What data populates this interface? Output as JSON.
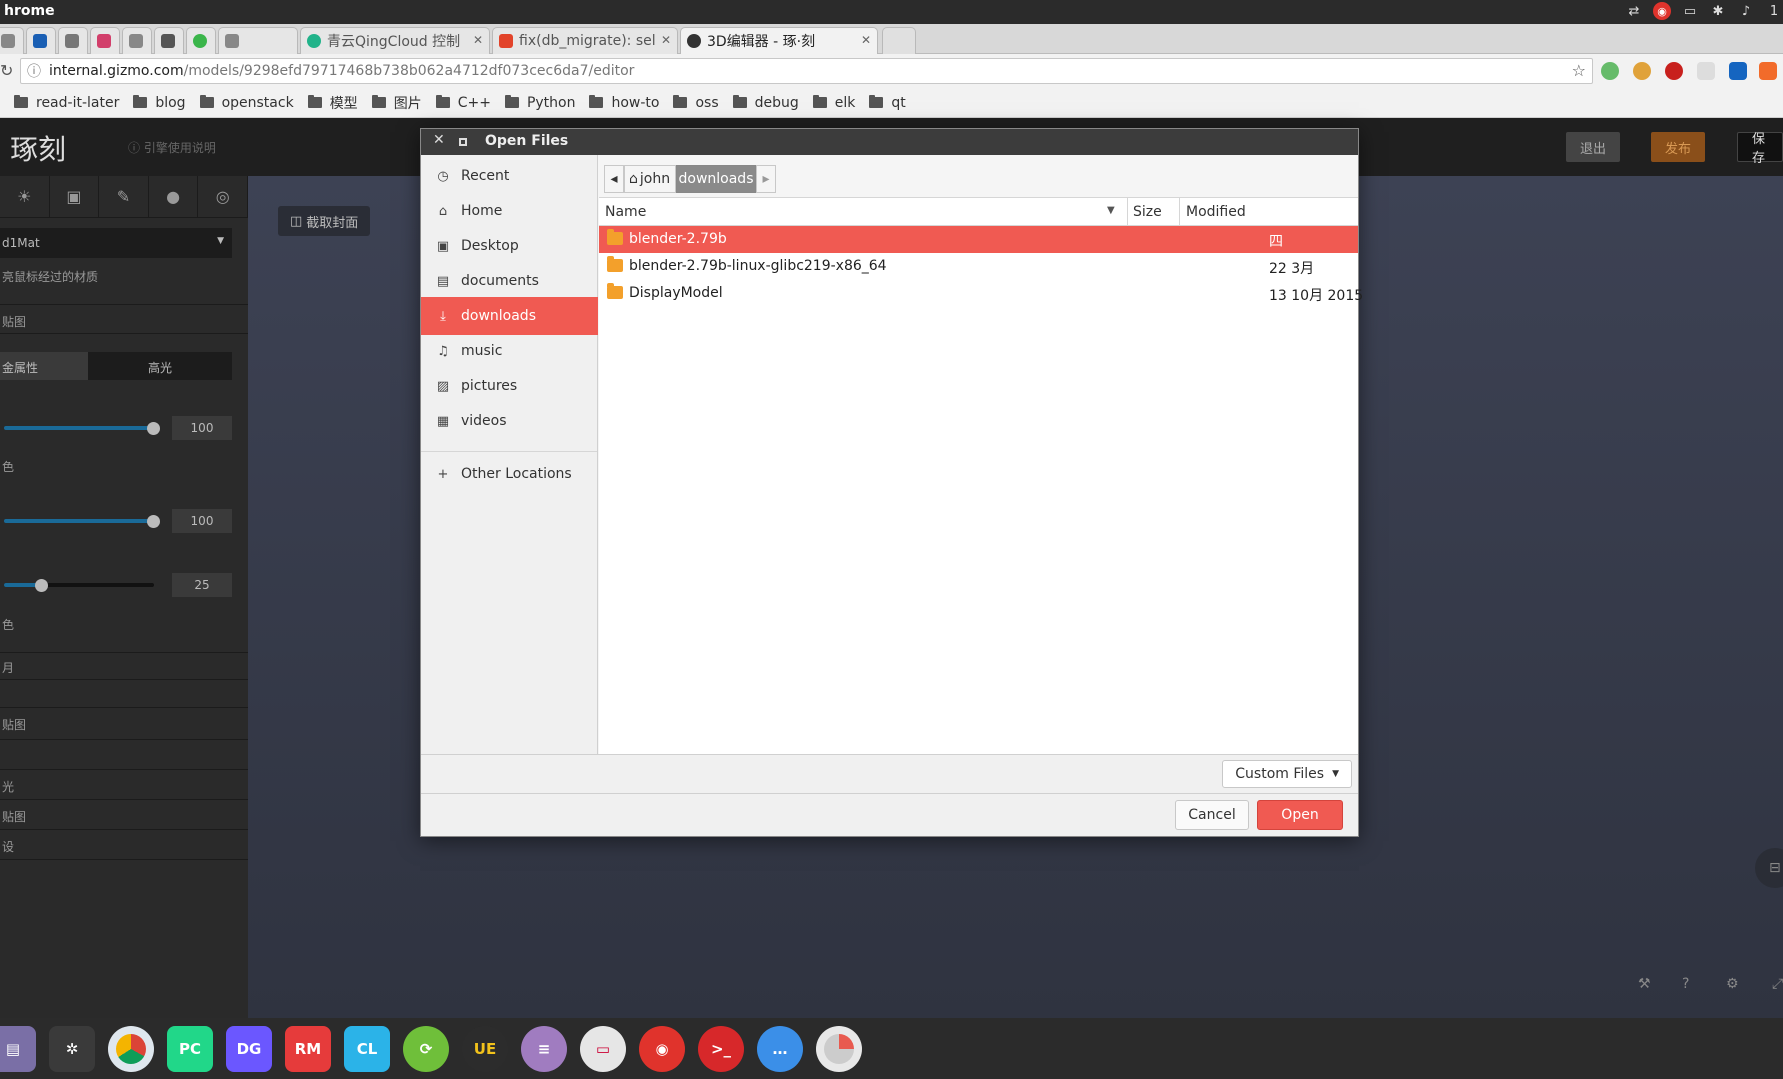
{
  "system": {
    "app_name": "hrome",
    "tray_label": "1"
  },
  "tabs": [
    {
      "label": "",
      "favicon_color": "#888888"
    },
    {
      "label": "",
      "favicon_color": "#1a5fb4"
    },
    {
      "label": "",
      "favicon_color": "#777777"
    },
    {
      "label": "",
      "favicon_color": "#d23f6b"
    },
    {
      "label": "",
      "favicon_color": "#888888"
    },
    {
      "label": "",
      "favicon_color": "#555555"
    },
    {
      "label": "",
      "favicon_color": "#3ab54a"
    },
    {
      "label": "",
      "favicon_color": "#888888"
    },
    {
      "label": "青云QingCloud 控制",
      "favicon_color": "#21b38a"
    },
    {
      "label": "fix(db_migrate): sel",
      "favicon_color": "#e2432a"
    },
    {
      "label": "3D编辑器 - 琢·刻",
      "favicon_color": "#333333"
    }
  ],
  "omnibox": {
    "host": "internal.gizmo.com",
    "path": "/models/9298efd79717468b738b062a4712df073cec6da7/editor"
  },
  "bookmarks": [
    "read-it-later",
    "blog",
    "openstack",
    "模型",
    "图片",
    "C++",
    "Python",
    "how-to",
    "oss",
    "debug",
    "elk",
    "qt"
  ],
  "page": {
    "logo": "琢刻",
    "help": "引擎使用说明",
    "quit": "退出",
    "publish": "发布",
    "save": "保存",
    "cover": "截取封面",
    "material_name": "d1Mat",
    "hint": "亮鼠标经过的材质",
    "section_texture": "贴图",
    "tab_metal": "金属性",
    "tab_highlight": "高光",
    "label_color": "色",
    "label_color2": "色",
    "slider1_value": "100",
    "slider2_value": "100",
    "slider3_value": "25",
    "slider1_fraction": 1.0,
    "slider2_fraction": 1.0,
    "slider3_fraction": 0.25,
    "row_a": "月",
    "row_b": "贴图",
    "row_c": "光",
    "row_d": "贴图",
    "row_e": "设"
  },
  "dialog": {
    "title": "Open Files",
    "places": [
      {
        "label": "Recent",
        "icon": "clock-icon"
      },
      {
        "label": "Home",
        "icon": "home-icon"
      },
      {
        "label": "Desktop",
        "icon": "desktop-icon"
      },
      {
        "label": "documents",
        "icon": "document-icon"
      },
      {
        "label": "downloads",
        "icon": "download-icon"
      },
      {
        "label": "music",
        "icon": "music-icon"
      },
      {
        "label": "pictures",
        "icon": "picture-icon"
      },
      {
        "label": "videos",
        "icon": "video-icon"
      },
      {
        "label": "Other Locations",
        "icon": "plus-icon"
      }
    ],
    "path": {
      "home": "john",
      "current": "downloads"
    },
    "columns": {
      "name": "Name",
      "size": "Size",
      "modified": "Modified"
    },
    "files": [
      {
        "name": "blender-2.79b",
        "size": "",
        "modified": "四"
      },
      {
        "name": "blender-2.79b-linux-glibc219-x86_64",
        "size": "",
        "modified": "22 3月"
      },
      {
        "name": "DisplayModel",
        "size": "",
        "modified": "13 10月 2015"
      }
    ],
    "filter": "Custom Files",
    "cancel": "Cancel",
    "open": "Open"
  },
  "dock": [
    {
      "label": "",
      "color": "#7a6fa6"
    },
    {
      "label": "",
      "color": "#3a3a3a"
    },
    {
      "label": "",
      "color": "#dfe7ee"
    },
    {
      "label": "PC",
      "color": "#21d789"
    },
    {
      "label": "DG",
      "color": "#6b57ff"
    },
    {
      "label": "RM",
      "color": "#e63b3b"
    },
    {
      "label": "CL",
      "color": "#2bb3e8"
    },
    {
      "label": "",
      "color": "#6fbf3a"
    },
    {
      "label": "UE",
      "color": "#2c2c2c"
    },
    {
      "label": "",
      "color": "#a07cc0"
    },
    {
      "label": "",
      "color": "#e6e6e6"
    },
    {
      "label": "",
      "color": "#e0332c"
    },
    {
      "label": "",
      "color": "#d7282a"
    },
    {
      "label": "",
      "color": "#3b8fe8"
    },
    {
      "label": "",
      "color": "#e8e8e8"
    }
  ],
  "colors": {
    "accent": "#f05a52",
    "folder": "#f3a02b"
  }
}
